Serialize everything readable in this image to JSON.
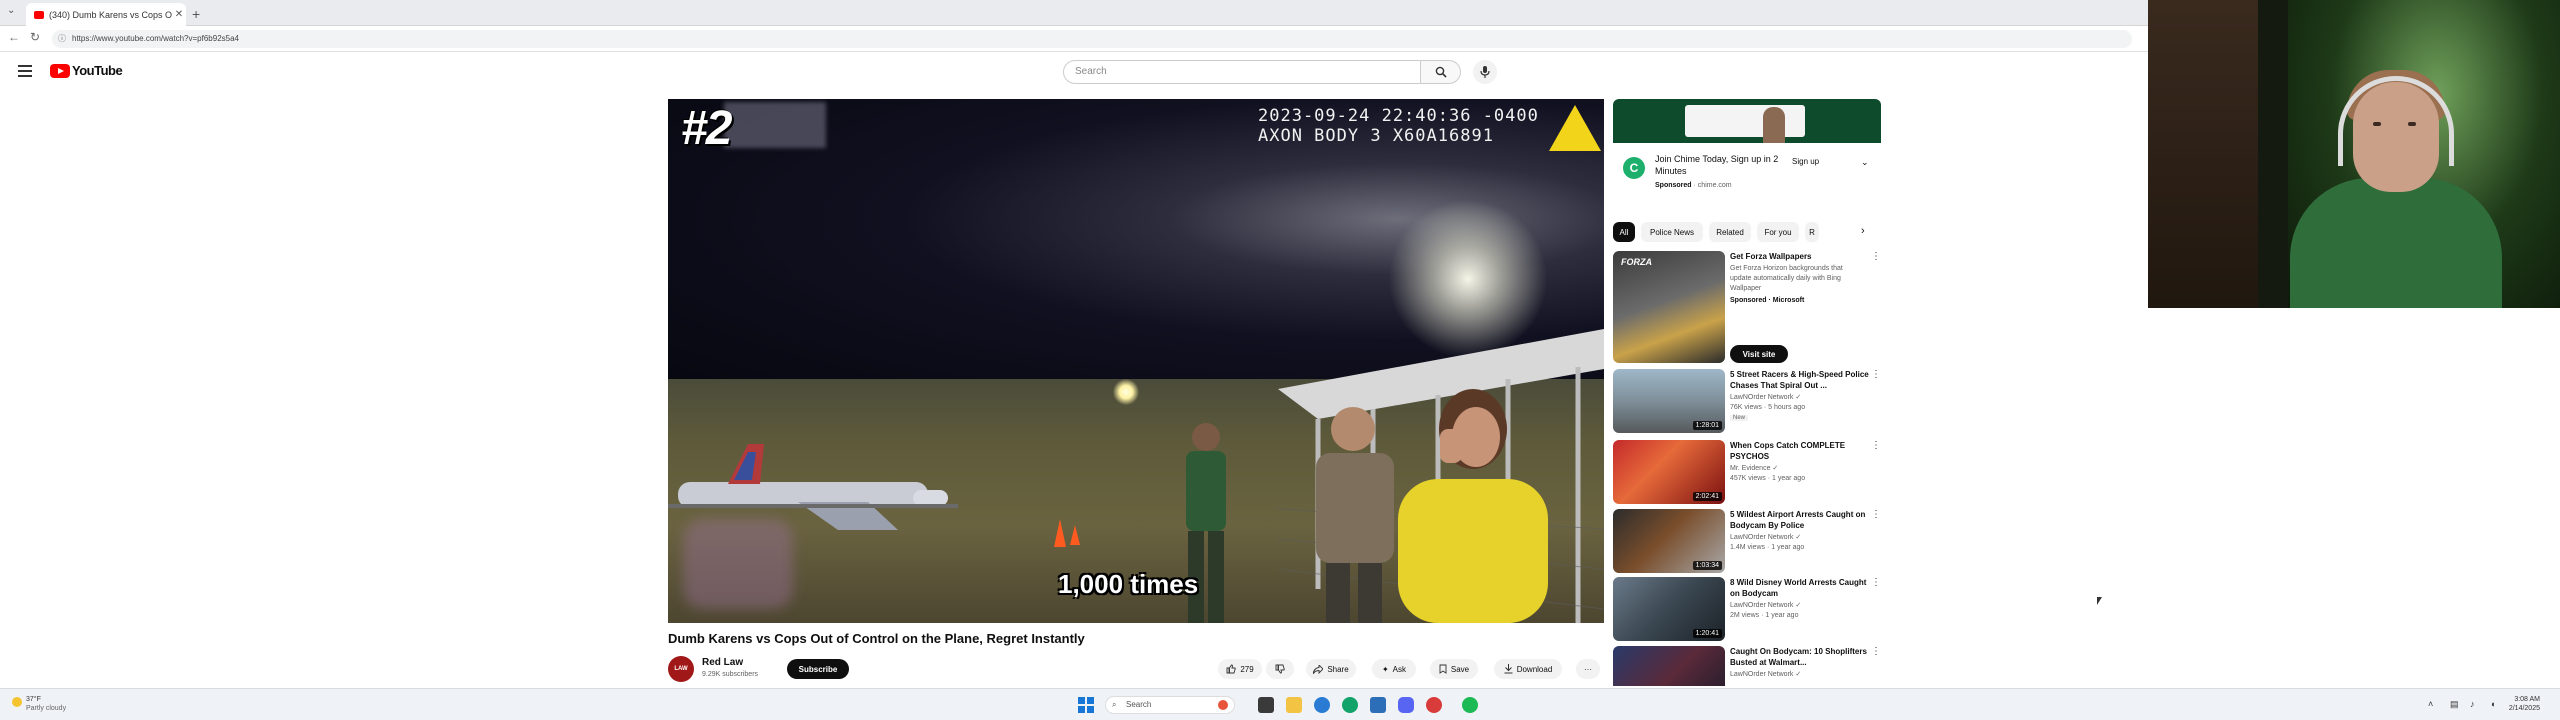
{
  "browser": {
    "tab_title": "(340) Dumb Karens vs Cops O...",
    "new_tab": "+",
    "close": "✕",
    "url": "https://www.youtube.com/watch?v=pf6b92s5a4"
  },
  "header": {
    "logo_text": "YouTube",
    "search_placeholder": "Search"
  },
  "player": {
    "overlay_rank": "#2",
    "timestamp_line1": "2023-09-24 22:40:36 -0400",
    "timestamp_line2": "AXON BODY 3 X60A16891",
    "caption": "1,000 times"
  },
  "video": {
    "title": "Dumb Karens vs Cops Out of Control on the Plane, Regret Instantly",
    "channel_name": "Red Law",
    "channel_avatar_text": "LAW",
    "subscribers": "9.29K subscribers",
    "subscribe_label": "Subscribe",
    "likes": "279",
    "share_label": "Share",
    "ask_label": "Ask",
    "save_label": "Save",
    "download_label": "Download",
    "more_label": "···"
  },
  "ad": {
    "logo_letter": "C",
    "text": "Join Chime Today, Sign up in 2 Minutes",
    "sponsored": "Sponsored",
    "domain": "chime.com",
    "signup_label": "Sign up"
  },
  "chips": [
    "All",
    "Police News",
    "Related",
    "For you",
    "R"
  ],
  "recommendations": [
    {
      "title": "Get Forza Wallpapers",
      "line1": "Get Forza Horizon backgrounds that",
      "line2": "update automatically daily with Bing",
      "line3": "Wallpaper",
      "meta": "Sponsored · Microsoft",
      "button": "Visit site",
      "duration": ""
    },
    {
      "title": "5 Street Racers & High-Speed Police Chases That Spiral Out ...",
      "channel": "LawNOrder Network",
      "stats": "76K views · 5 hours ago",
      "badge": "New",
      "duration": "1:28:01"
    },
    {
      "title": "When Cops Catch COMPLETE PSYCHOS",
      "channel": "Mr. Evidence",
      "stats": "457K views · 1 year ago",
      "duration": "2:02:41"
    },
    {
      "title": "5 Wildest Airport Arrests Caught on Bodycam By Police",
      "channel": "LawNOrder Network",
      "stats": "1.4M views · 1 year ago",
      "duration": "1:03:34"
    },
    {
      "title": "8 Wild Disney World Arrests Caught on Bodycam",
      "channel": "LawNOrder Network",
      "stats": "2M views · 1 year ago",
      "duration": "1:20:41"
    },
    {
      "title": "Caught On Bodycam: 10 Shoplifters Busted at Walmart...",
      "channel": "LawNOrder Network",
      "stats": "",
      "duration": ""
    }
  ],
  "taskbar": {
    "weather_temp": "37°F",
    "weather_desc": "Partly cloudy",
    "search_label": "Search",
    "time": "3:08 AM",
    "date": "2/14/2025"
  },
  "colors": {
    "yt_red": "#ff0000",
    "subscribe_bg": "#0f0f0f",
    "chip_bg": "#f2f2f2",
    "axon_yellow": "#f2d51a"
  }
}
